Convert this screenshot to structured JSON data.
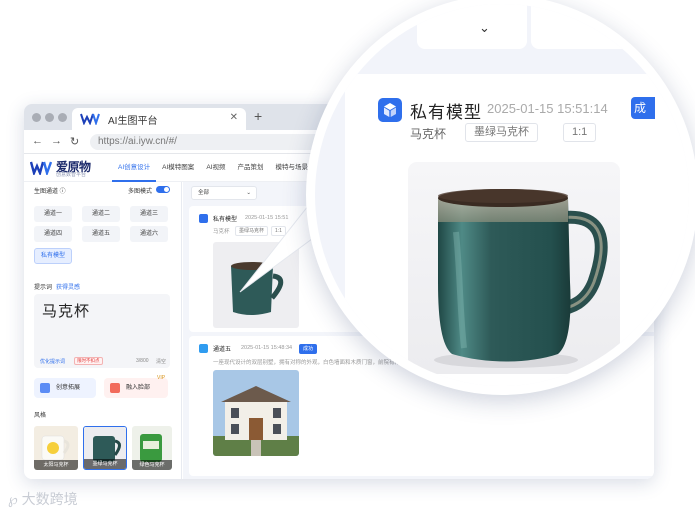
{
  "browser": {
    "tab_title": "AI生图平台",
    "url": "https://ai.iyw.cn/#/"
  },
  "app": {
    "brand_name": "爱原物",
    "brand_sub": "创意数智平台",
    "nav": [
      "AI创意设计",
      "AI模特图案",
      "AI视频",
      "产品策划",
      "模特与场景"
    ]
  },
  "left": {
    "channel_label": "生图通道 ⓘ",
    "multi_mode": "多图模式",
    "channels": [
      "通道一",
      "通道二",
      "通道三",
      "通道四",
      "通道五",
      "通道六",
      "私有模型"
    ],
    "prompt_label": "提示词",
    "prompt_link": "获得灵感",
    "prompt_value": "马克杯",
    "optimize": "优化提示词",
    "counter": "3/800",
    "clear": "清空",
    "tag_free": "限时不扣点",
    "pill1": "创意拓展",
    "pill2": "融入脸部",
    "pill_badge": "VIP",
    "style_label": "风格",
    "styles": [
      "太阳马克杯",
      "墨绿马克杯",
      "绿色马克杯"
    ]
  },
  "main": {
    "filter": "全部",
    "card1": {
      "title": "私有模型",
      "time": "2025-01-15 15:51",
      "product": "马克杯",
      "tag1": "墨绿马克杯",
      "tag2": "1:1"
    },
    "card2": {
      "title": "通道五",
      "time": "2025-01-15 15:48:34",
      "status": "成功",
      "desc": "一座现代设计的双层别墅，拥有对称的外观，白色墙面和木质门窗，前院有精心修剪的草坪和花园，别墅在蓝天白云的映衬下显得格外宁静舒适..."
    }
  },
  "magnifier": {
    "title": "私有模型",
    "time": "2025-01-15 15:51:14",
    "badge": "成",
    "product": "马克杯",
    "tag1": "墨绿马克杯",
    "tag2": "1:1"
  },
  "watermark": "大数跨境",
  "colors": {
    "accent": "#2f6fec",
    "mug_green": "#2e5a58"
  }
}
